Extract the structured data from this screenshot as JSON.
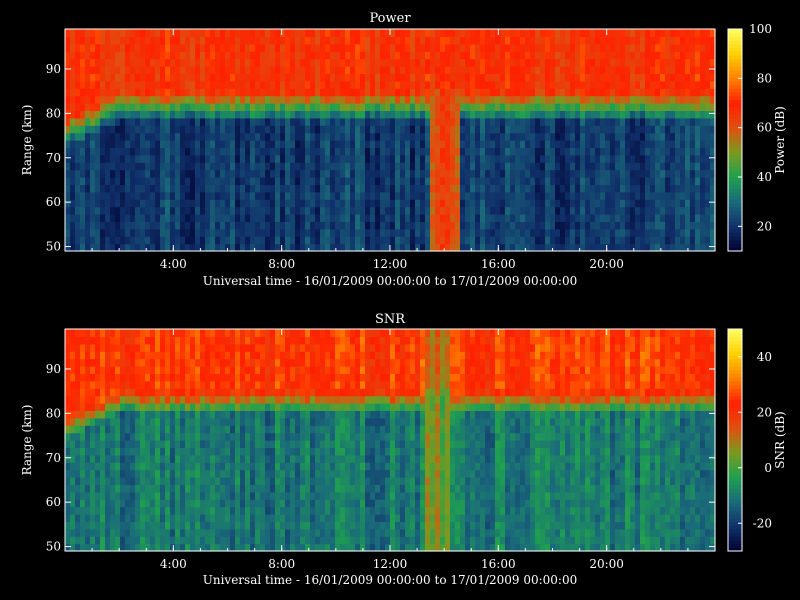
{
  "chart_data": [
    {
      "type": "heatmap",
      "title": "Power",
      "xlabel": "Universal time - 16/01/2009 00:00:00 to 17/01/2009 00:00:00",
      "ylabel": "Range (km)",
      "xlim_hours": [
        0,
        24
      ],
      "ylim": [
        49,
        99
      ],
      "x_tick_labels": [
        "4:00",
        "8:00",
        "12:00",
        "16:00",
        "20:00"
      ],
      "x_tick_values_hours": [
        4,
        8,
        12,
        16,
        20
      ],
      "y_ticks": [
        50,
        60,
        70,
        80,
        90
      ],
      "colorbar": {
        "label": "Power (dB)",
        "range": [
          10,
          100
        ],
        "ticks": [
          20,
          40,
          60,
          80,
          100
        ]
      },
      "colormap": [
        "#000030",
        "#10306a",
        "#1a6a7a",
        "#1fa050",
        "#7a9a20",
        "#e05010",
        "#ff2000",
        "#ff8000",
        "#ffd000",
        "#ffff60"
      ],
      "description_of_field": {
        "lower_region_km": [
          49,
          78
        ],
        "lower_region_db": 22,
        "transition_km": [
          78,
          85
        ],
        "transition_db": 45,
        "upper_region_km": [
          85,
          99
        ],
        "upper_region_db": 68,
        "disturbed_interval_hours": [
          13.5,
          14.5
        ],
        "disturbed_interval_db": 62
      }
    },
    {
      "type": "heatmap",
      "title": "SNR",
      "xlabel": "Universal time - 16/01/2009 00:00:00 to 17/01/2009 00:00:00",
      "ylabel": "Range (km)",
      "xlim_hours": [
        0,
        24
      ],
      "ylim": [
        49,
        99
      ],
      "x_tick_labels": [
        "4:00",
        "8:00",
        "12:00",
        "16:00",
        "20:00"
      ],
      "x_tick_values_hours": [
        4,
        8,
        12,
        16,
        20
      ],
      "y_ticks": [
        50,
        60,
        70,
        80,
        90
      ],
      "colorbar": {
        "label": "SNR (dB)",
        "range": [
          -30,
          50
        ],
        "ticks": [
          -20,
          0,
          20,
          40
        ]
      },
      "colormap": [
        "#000030",
        "#10306a",
        "#1a6a7a",
        "#1fa050",
        "#7a9a20",
        "#e05010",
        "#ff2000",
        "#ff8000",
        "#ffd000",
        "#ffff60"
      ],
      "description_of_field": {
        "lower_region_km": [
          49,
          80
        ],
        "lower_region_db": -10,
        "transition_km": [
          80,
          86
        ],
        "transition_db": 10,
        "upper_region_km": [
          86,
          99
        ],
        "upper_region_db": 25,
        "disturbed_interval_hours": [
          13.3,
          14.3
        ],
        "disturbed_interval_db": 5
      }
    }
  ]
}
